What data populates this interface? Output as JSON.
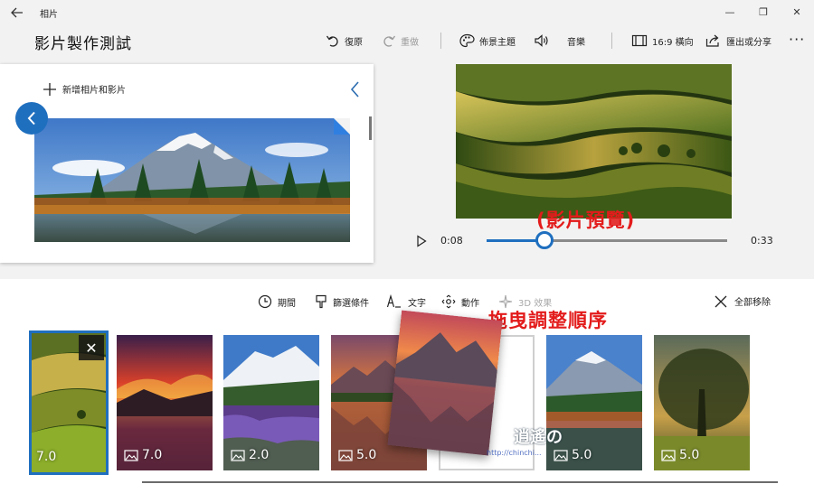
{
  "titlebar": {
    "app_name": "相片",
    "back_icon": "back-arrow-icon",
    "minimize_label": "—",
    "restore_label": "❐",
    "close_label": "✕"
  },
  "header": {
    "title": "影片製作測試",
    "undo_label": "復原",
    "redo_label": "重做",
    "theme_label": "佈景主題",
    "music_label": "音樂",
    "aspect_label": "16:9 橫向",
    "export_label": "匯出或分享",
    "more_label": "···"
  },
  "library": {
    "add_label": "新增相片和影片"
  },
  "preview": {
    "caption": "(影片預覽)",
    "current_time": "0:08",
    "total_time": "0:33",
    "progress": 0.24
  },
  "storyboard": {
    "tools": {
      "duration": "期間",
      "filters": "篩選條件",
      "text": "文字",
      "motion": "動作",
      "effects_3d": "3D 效果"
    },
    "remove_all_label": "全部移除",
    "drag_caption": "拖曳調整順序",
    "clips": [
      {
        "duration": "7.0",
        "selected": true
      },
      {
        "duration": "7.0"
      },
      {
        "duration": "2.0"
      },
      {
        "duration": "5.0"
      },
      {
        "duration": "5.0"
      },
      {
        "duration": "5.0"
      }
    ],
    "watermark": "http://chinchi...",
    "watermark_big": "逍遙の"
  },
  "colors": {
    "accent": "#1f6fbf",
    "annotation": "#e31b1b"
  }
}
